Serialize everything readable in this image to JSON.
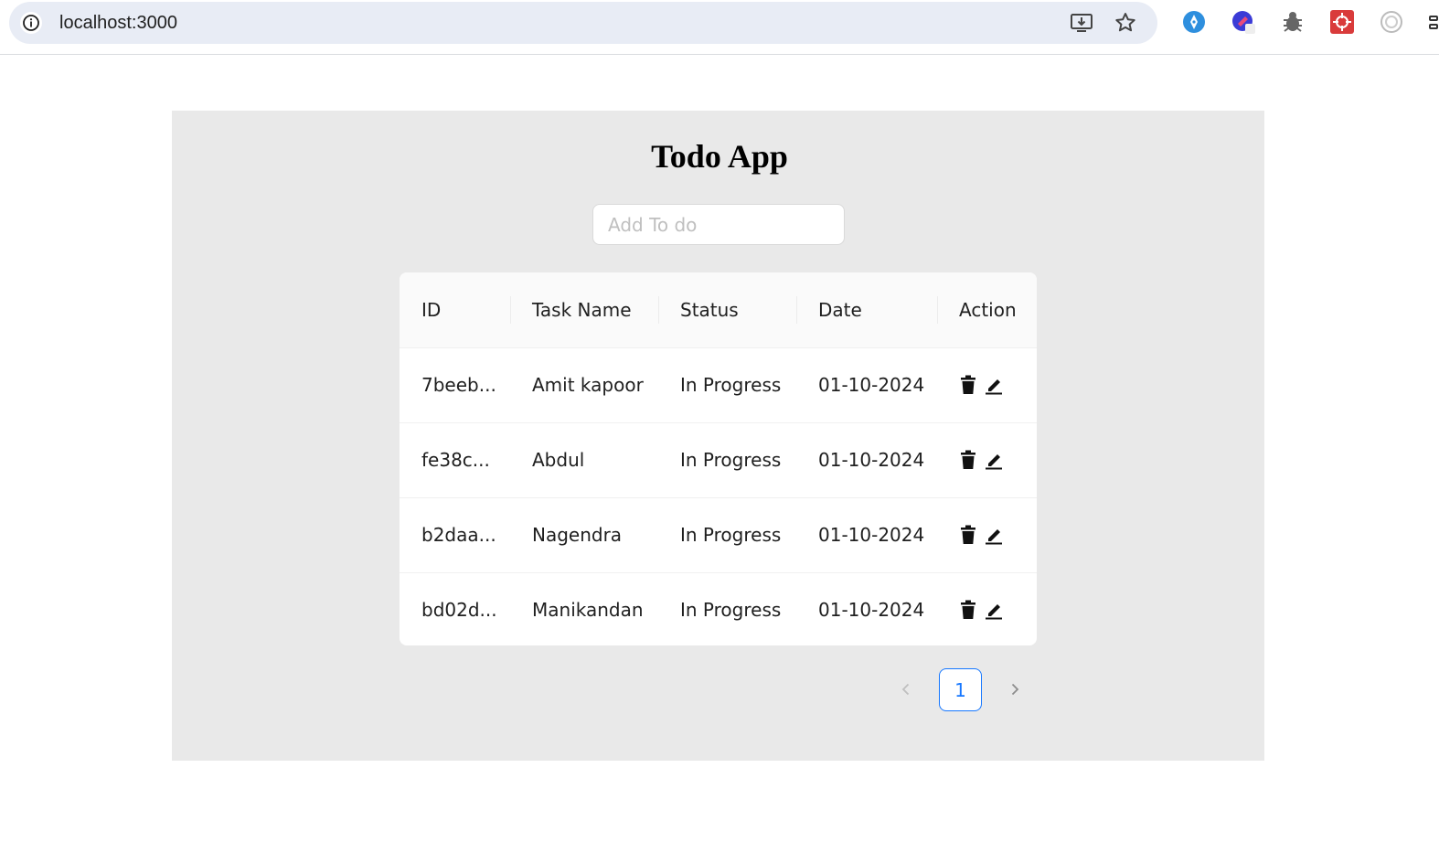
{
  "browser": {
    "url": "localhost:3000"
  },
  "app": {
    "title": "Todo App",
    "input_placeholder": "Add To do"
  },
  "table": {
    "columns": [
      "ID",
      "Task Name",
      "Status",
      "Date",
      "Action"
    ],
    "rows": [
      {
        "id": "7beeb...",
        "task": "Amit kapoor",
        "status": "In Progress",
        "date": "01-10-2024"
      },
      {
        "id": "fe38c...",
        "task": "Abdul",
        "status": "In Progress",
        "date": "01-10-2024"
      },
      {
        "id": "b2daa...",
        "task": "Nagendra",
        "status": "In Progress",
        "date": "01-10-2024"
      },
      {
        "id": "bd02d...",
        "task": "Manikandan",
        "status": "In Progress",
        "date": "01-10-2024"
      }
    ]
  },
  "pagination": {
    "current_page": "1"
  },
  "colors": {
    "accent": "#1677ff",
    "panel_bg": "#e9e9e9"
  }
}
